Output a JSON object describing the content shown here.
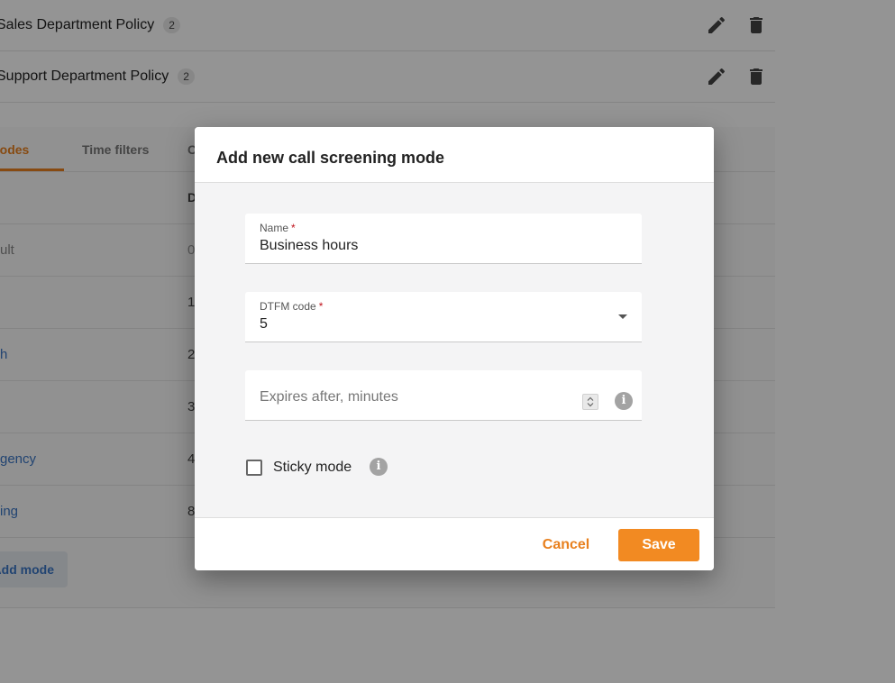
{
  "policies": [
    {
      "name": "Sales Department Policy",
      "count": "2"
    },
    {
      "name": "Support Department Policy",
      "count": "2"
    }
  ],
  "tabs": {
    "modes": "Modes",
    "time_filters": "Time filters",
    "third": "C"
  },
  "table": {
    "header_col2": "D",
    "rows": [
      {
        "name": "ult",
        "code": "0"
      },
      {
        "name": "",
        "code": "1"
      },
      {
        "name": "h",
        "code": "2"
      },
      {
        "name": "",
        "code": "3"
      },
      {
        "name": "gency",
        "code": "4"
      },
      {
        "name": "ing",
        "code": "8"
      }
    ],
    "add_mode": "Add mode"
  },
  "dialog": {
    "title": "Add new call screening mode",
    "name_label": "Name",
    "name_value": "Business hours",
    "dtfm_label": "DTFM code",
    "dtfm_value": "5",
    "expires_placeholder": "Expires after, minutes",
    "sticky_label": "Sticky mode",
    "required_mark": "*",
    "info_glyph": "i",
    "cancel": "Cancel",
    "save": "Save"
  },
  "colors": {
    "accent": "#f28a22",
    "link": "#3a75c4"
  }
}
